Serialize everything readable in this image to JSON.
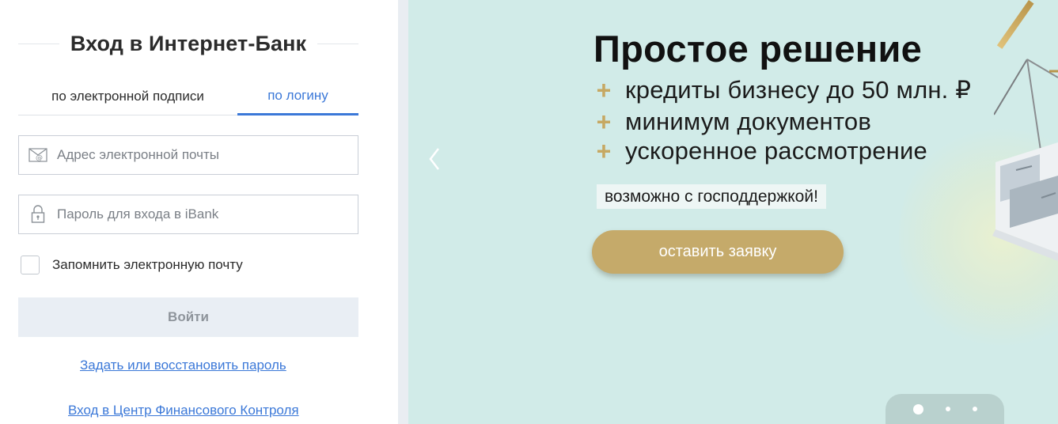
{
  "login": {
    "title": "Вход в Интернет-Банк",
    "tabs": [
      {
        "label": "по электронной подписи",
        "active": false
      },
      {
        "label": "по логину",
        "active": true
      }
    ],
    "email_placeholder": "Адрес электронной почты",
    "password_placeholder": "Пароль для входа в iBank",
    "remember_label": "Запомнить электронную почту",
    "remember_checked": false,
    "submit_label": "Войти",
    "restore_link": "Задать или восстановить пароль",
    "center_link": "Вход в Центр Финансового Контроля"
  },
  "banner": {
    "title": "Простое решение",
    "bullets": [
      "кредиты бизнесу до 50 млн. ₽",
      "минимум документов",
      "ускоренное рассмотрение"
    ],
    "bullet_icon": "plus-icon",
    "note": "возможно с господдержкой!",
    "cta_label": "оставить заявку",
    "slides_count": 3,
    "active_slide": 1,
    "colors": {
      "background": "#d1ebe8",
      "accent_gold": "#c5aa6a",
      "link_blue": "#3b78d8"
    }
  }
}
